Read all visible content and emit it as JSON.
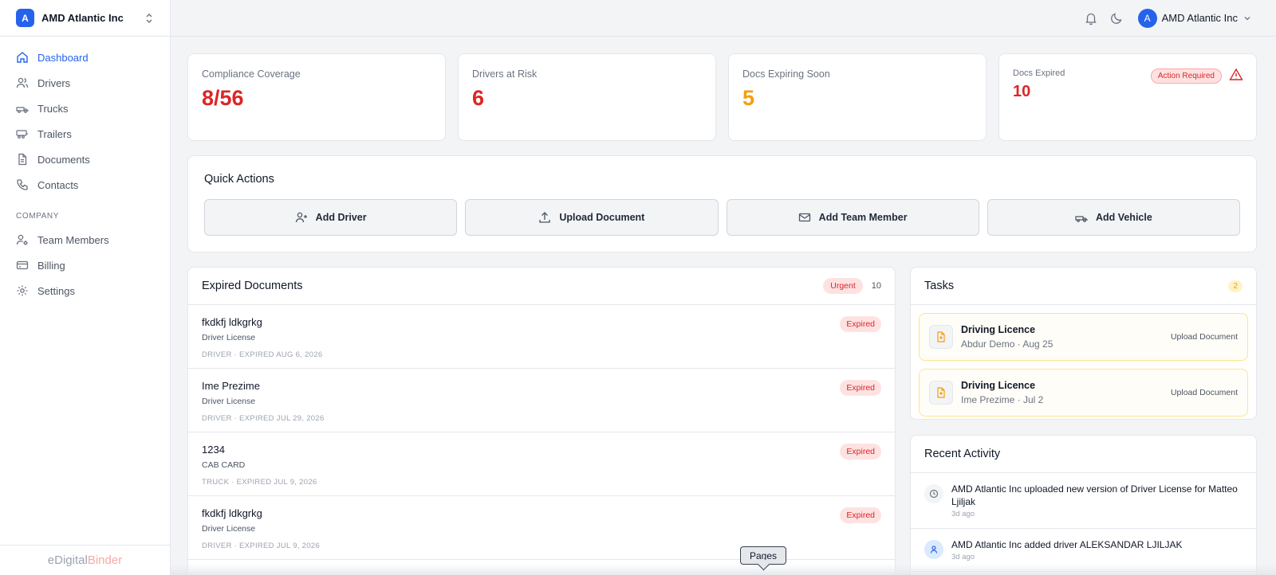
{
  "org": {
    "badge": "A",
    "name": "AMD Atlantic Inc"
  },
  "nav": {
    "main": [
      {
        "label": "Dashboard",
        "icon": "home-icon",
        "active": true
      },
      {
        "label": "Drivers",
        "icon": "users-icon"
      },
      {
        "label": "Trucks",
        "icon": "truck-icon"
      },
      {
        "label": "Trailers",
        "icon": "trailer-icon"
      },
      {
        "label": "Documents",
        "icon": "file-icon"
      },
      {
        "label": "Contacts",
        "icon": "phone-icon"
      }
    ],
    "section_label": "COMPANY",
    "company": [
      {
        "label": "Team Members",
        "icon": "user-cog-icon"
      },
      {
        "label": "Billing",
        "icon": "credit-card-icon"
      },
      {
        "label": "Settings",
        "icon": "gear-icon"
      }
    ]
  },
  "footer": {
    "brand_part1": "eDigital",
    "brand_part2": "Binder"
  },
  "topbar": {
    "user_initial": "A",
    "user_name": "AMD Atlantic Inc"
  },
  "stats": [
    {
      "label": "Compliance Coverage",
      "value": "8/56",
      "color": "#dc2626"
    },
    {
      "label": "Drivers at Risk",
      "value": "6",
      "color": "#dc2626"
    },
    {
      "label": "Docs Expiring Soon",
      "value": "5",
      "color": "#f59e0b"
    },
    {
      "label": "Docs Expired",
      "value": "10",
      "color": "#dc2626",
      "badge": "Action Required"
    }
  ],
  "quick_actions": {
    "title": "Quick Actions",
    "buttons": [
      {
        "label": "Add Driver",
        "icon": "user-plus-icon"
      },
      {
        "label": "Upload Document",
        "icon": "upload-icon"
      },
      {
        "label": "Add Team Member",
        "icon": "mail-icon"
      },
      {
        "label": "Add Vehicle",
        "icon": "truck-icon"
      }
    ]
  },
  "expired_docs": {
    "title": "Expired Documents",
    "urgent_label": "Urgent",
    "count": "10",
    "rows": [
      {
        "name": "fkdkfj ldkgrkg",
        "type": "Driver License",
        "meta": "DRIVER · EXPIRED AUG 6, 2026",
        "status": "Expired"
      },
      {
        "name": "Ime Prezime",
        "type": "Driver License",
        "meta": "DRIVER · EXPIRED JUL 29, 2026",
        "status": "Expired"
      },
      {
        "name": "1234",
        "type": "CAB CARD",
        "meta": "TRUCK · EXPIRED JUL 9, 2026",
        "status": "Expired"
      },
      {
        "name": "fkdkfj ldkgrkg",
        "type": "Driver License",
        "meta": "DRIVER · EXPIRED JUL 9, 2026",
        "status": "Expired"
      }
    ]
  },
  "tasks": {
    "title": "Tasks",
    "count": "2",
    "items": [
      {
        "title": "Driving Licence",
        "subtitle": "Abdur Demo · Aug 25",
        "action": "Upload Document"
      },
      {
        "title": "Driving Licence",
        "subtitle": "Ime Prezime · Jul 2",
        "action": "Upload Document"
      }
    ]
  },
  "activity": {
    "title": "Recent Activity",
    "items": [
      {
        "message": "AMD Atlantic Inc uploaded new version of Driver License for Matteo Ljiljak",
        "time": "3d ago",
        "icon": "clock-icon"
      },
      {
        "message": "AMD Atlantic Inc added driver ALEKSANDAR LJILJAK",
        "time": "3d ago",
        "icon": "user-icon"
      }
    ]
  },
  "tooltip": "Pages"
}
